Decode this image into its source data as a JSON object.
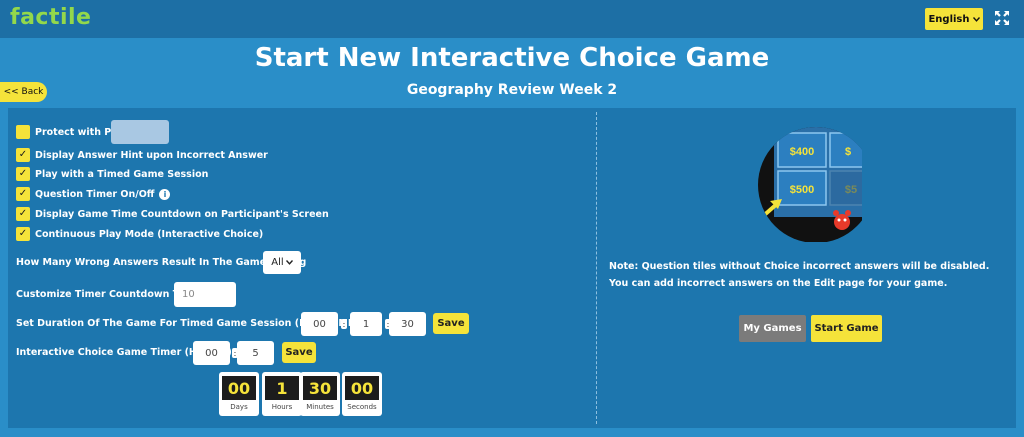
{
  "header": {
    "logo": "factile",
    "language": "English",
    "language_icon": "chevron-down-icon",
    "fullscreen_icon": "fullscreen-icon"
  },
  "page": {
    "title": "Start New Interactive Choice Game",
    "subtitle": "Geography Review Week 2",
    "back_label": "<< Back"
  },
  "options": [
    {
      "label": "Protect with PIN",
      "checked": false
    },
    {
      "label": "Display Answer Hint upon Incorrect Answer",
      "checked": true
    },
    {
      "label": "Play with a Timed Game Session",
      "checked": true
    },
    {
      "label": "Question Timer On/Off",
      "checked": true
    },
    {
      "label": "Display Game Time Countdown on Participant's Screen",
      "checked": true
    },
    {
      "label": "Continuous Play Mode (Interactive Choice)",
      "checked": true
    }
  ],
  "pin": {
    "value": ""
  },
  "settings": {
    "wrong_answers_label": "How Many Wrong Answers Result In The Game Ending",
    "wrong_answers_value": "All",
    "countdown_label": "Customize Timer Countdown Time",
    "countdown_placeholder": "10",
    "duration_label": "Set Duration Of The Game For Timed Game Session (DD:HH:MM)",
    "duration_days": "00",
    "duration_hours": "1",
    "duration_minutes": "30",
    "choice_timer_label": "Interactive Choice Game Timer (HH:MM)",
    "choice_timer_hours": "00",
    "choice_timer_minutes": "5",
    "save_label": "Save",
    "colon": ":"
  },
  "timer_display": [
    {
      "value": "00",
      "label": "Days"
    },
    {
      "value": "1",
      "label": "Hours"
    },
    {
      "value": "30",
      "label": "Minutes"
    },
    {
      "value": "00",
      "label": "Seconds"
    }
  ],
  "preview": {
    "tiles": [
      "$400",
      "$",
      "$500",
      "$5"
    ]
  },
  "note": "Note: Question tiles without Choice incorrect answers will be disabled. You can add incorrect answers on the Edit page for your game.",
  "actions": {
    "my_games": "My Games",
    "start_game": "Start Game"
  },
  "colors": {
    "background": "#2a8ec8",
    "topbar": "#1d6fa5",
    "panel": "#1d76ae",
    "accent_yellow": "#f5e33a",
    "logo_green": "#93d84b",
    "my_games_gray": "#7b7b7b"
  }
}
